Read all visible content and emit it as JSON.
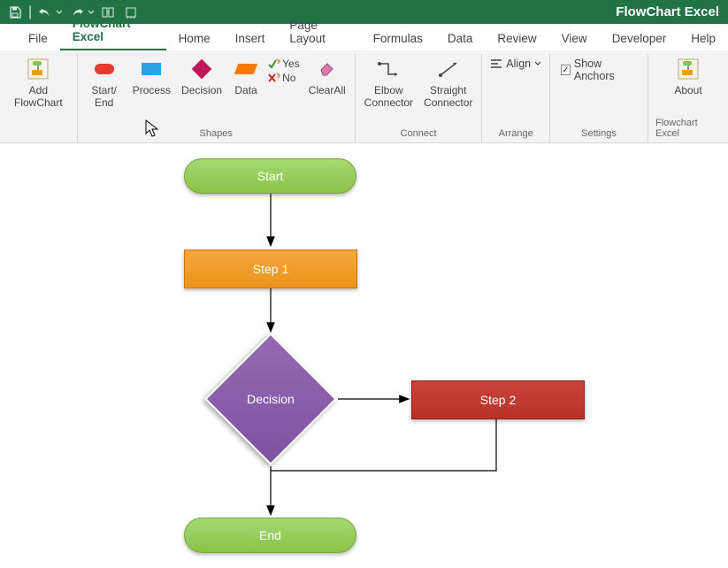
{
  "titlebar": {
    "app_title": "FlowChart Excel"
  },
  "qat": {
    "save": "save-icon",
    "undo": "undo-icon",
    "redo": "redo-icon",
    "gridsnap": "grid-snap-icon",
    "gridtoggle": "grid-toggle-icon"
  },
  "tabs": {
    "file": "File",
    "flowchart": "FlowChart Excel",
    "home": "Home",
    "insert": "Insert",
    "pagelayout": "Page Layout",
    "formulas": "Formulas",
    "data": "Data",
    "review": "Review",
    "view": "View",
    "developer": "Developer",
    "help": "Help"
  },
  "ribbon": {
    "addflowchart": {
      "label": "Add\nFlowChart",
      "group_label": ""
    },
    "shapes": {
      "group_label": "Shapes",
      "startend": "Start/\nEnd",
      "process": "Process",
      "decision": "Decision",
      "data": "Data",
      "yes": "Yes",
      "no": "No",
      "clearall": "ClearAll"
    },
    "connect": {
      "group_label": "Connect",
      "elbow": "Elbow\nConnector",
      "straight": "Straight\nConnector"
    },
    "arrange": {
      "group_label": "Arrange",
      "align": "Align"
    },
    "settings": {
      "group_label": "Settings",
      "showanchors": "Show Anchors",
      "checked": "✓"
    },
    "about": {
      "group_label": "Flowchart Excel",
      "about": "About"
    }
  },
  "canvas": {
    "start": "Start",
    "step1": "Step 1",
    "decision": "Decision",
    "step2": "Step 2",
    "end": "End"
  }
}
